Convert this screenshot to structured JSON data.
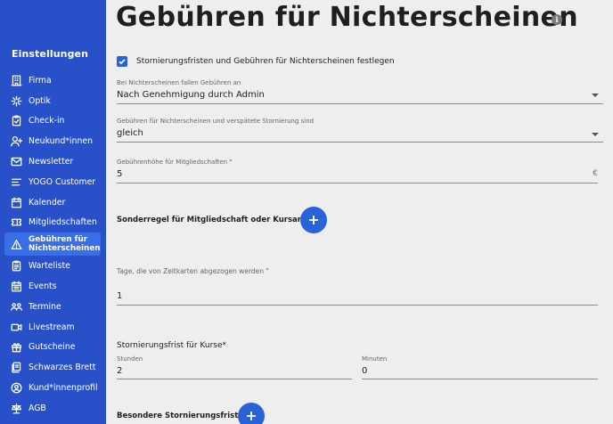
{
  "sidebar": {
    "title": "Einstellungen",
    "items": [
      {
        "label": "Firma",
        "icon": "building-icon"
      },
      {
        "label": "Optik",
        "icon": "sparkle-icon"
      },
      {
        "label": "Check-in",
        "icon": "clipboard-check-icon"
      },
      {
        "label": "Neukund*innen",
        "icon": "user-plus-icon"
      },
      {
        "label": "Newsletter",
        "icon": "mail-icon"
      },
      {
        "label": "YOGO Customer",
        "icon": "lines-icon"
      },
      {
        "label": "Kalender",
        "icon": "calendar-icon"
      },
      {
        "label": "Mitgliedschaften",
        "icon": "ticket-icon"
      },
      {
        "label": "Gebühren für Nichterscheinen",
        "icon": "warning-icon",
        "active": true
      },
      {
        "label": "Warteliste",
        "icon": "clipboard-list-icon"
      },
      {
        "label": "Events",
        "icon": "calendar-list-icon"
      },
      {
        "label": "Termine",
        "icon": "users-icon"
      },
      {
        "label": "Livestream",
        "icon": "video-icon"
      },
      {
        "label": "Gutscheine",
        "icon": "gift-icon"
      },
      {
        "label": "Schwarzes Brett",
        "icon": "board-icon"
      },
      {
        "label": "Kund*innenprofil",
        "icon": "user-circle-icon"
      },
      {
        "label": "AGB",
        "icon": "scale-icon"
      }
    ]
  },
  "main": {
    "title": "Gebühren für Nichterscheinen",
    "info_symbol": "i",
    "checkbox_label": "Stornierungsfristen und Gebühren für Nichterscheinen festlegen",
    "checkbox_checked": true,
    "fee_trigger": {
      "label": "Bei Nichterscheinen fallen Gebühren an",
      "value": "Nach Genehmigung durch Admin"
    },
    "fee_compare": {
      "label": "Gebühren für Nichterscheinen und verspätete Stornierung sind",
      "value": "gleich"
    },
    "fee_amount": {
      "label": "Gebührenhöhe für Mitgliedschaften",
      "required": "*",
      "value": "5",
      "unit": "€"
    },
    "special_rule_title": "Sonderregel für Mitgliedschaft oder Kursart",
    "days_deducted": {
      "label": "Tage, die von Zeitkarten abgezogen werden",
      "required": "*",
      "value": "1"
    },
    "cancel_deadline_title": "Stornierungsfrist für Kurse*",
    "hours": {
      "label": "Stunden",
      "value": "2"
    },
    "minutes": {
      "label": "Minuten",
      "value": "0"
    },
    "special_deadline_title": "Besondere Stornierungsfrist"
  },
  "colors": {
    "sidebar": "#2851c9",
    "active_item": "#3a6ee6",
    "accent": "#2a63d8",
    "background": "#eeeeee"
  }
}
